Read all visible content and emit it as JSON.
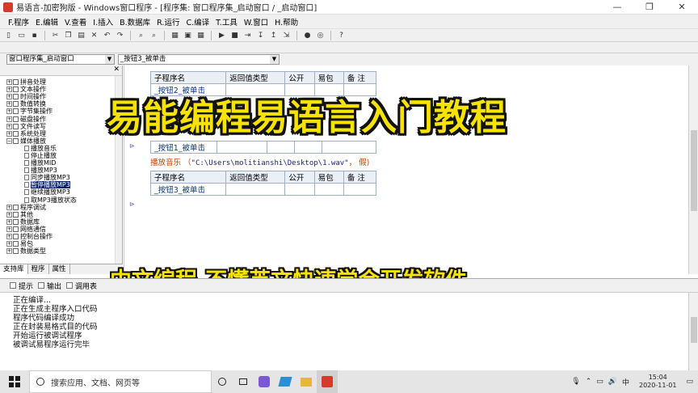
{
  "window": {
    "title": "易语言-加密狗版 - Windows窗口程序 - [程序集: 窗口程序集_启动窗口 / _启动窗口]",
    "controls": [
      "—",
      "❐",
      "✕"
    ]
  },
  "menu": [
    "F.程序",
    "E.编辑",
    "V.查看",
    "I.插入",
    "B.数据库",
    "R.运行",
    "C.编译",
    "T.工具",
    "W.窗口",
    "H.帮助"
  ],
  "selectors": {
    "left": "窗口程序集_启动窗口",
    "right": "_按钮3_被单击"
  },
  "tree": [
    {
      "label": "拼音处理",
      "type": "folder",
      "indent": 0
    },
    {
      "label": "文本操作",
      "type": "folder",
      "indent": 0
    },
    {
      "label": "时间操作",
      "type": "folder",
      "indent": 0
    },
    {
      "label": "数值转换",
      "type": "folder",
      "indent": 0
    },
    {
      "label": "字节集操作",
      "type": "folder",
      "indent": 0
    },
    {
      "label": "磁盘操作",
      "type": "folder",
      "indent": 0
    },
    {
      "label": "文件读写",
      "type": "folder",
      "indent": 0
    },
    {
      "label": "系统处理",
      "type": "folder",
      "indent": 0
    },
    {
      "label": "媒体播放",
      "type": "open",
      "indent": 0
    },
    {
      "label": "播放音乐",
      "type": "leaf",
      "indent": 1
    },
    {
      "label": "停止播放",
      "type": "leaf",
      "indent": 1
    },
    {
      "label": "播放MID",
      "type": "leaf",
      "indent": 1
    },
    {
      "label": "播放MP3",
      "type": "leaf",
      "indent": 1
    },
    {
      "label": "同步播放MP3",
      "type": "leaf",
      "indent": 1
    },
    {
      "label": "暂停播放MP3",
      "type": "leaf",
      "indent": 1,
      "selected": true
    },
    {
      "label": "继续播放MP3",
      "type": "leaf",
      "indent": 1
    },
    {
      "label": "取MP3播放状态",
      "type": "leaf",
      "indent": 1
    },
    {
      "label": "程序调试",
      "type": "folder",
      "indent": 0
    },
    {
      "label": "其他",
      "type": "folder",
      "indent": 0
    },
    {
      "label": "数据库",
      "type": "folder",
      "indent": 0
    },
    {
      "label": "网络通信",
      "type": "folder",
      "indent": 0
    },
    {
      "label": "控制台操作",
      "type": "folder",
      "indent": 0
    },
    {
      "label": "易包",
      "type": "folder",
      "indent": 0
    },
    {
      "label": "数据类型",
      "type": "folder",
      "indent": 0
    }
  ],
  "left_tabs": [
    "支持库",
    "程序",
    "属性"
  ],
  "editor": {
    "headers": [
      "子程序名",
      "返回值类型",
      "公开",
      "易包",
      "备 注"
    ],
    "sub1": "_按钮2_被单击",
    "sub2": "_按钮1_被单击",
    "code": "播放音乐 （",
    "code_str": "\"C:\\Users\\molitianshi\\Desktop\\1.wav\"",
    "code_end": "， 假)",
    "sub3": "_按钮3_被单击"
  },
  "overlay": {
    "title": "易能编程易语言入门教程",
    "subtitle": "中文编程,不懂英文快速学会开发软件"
  },
  "output_tabs": [
    "提示",
    "输出",
    "调用表"
  ],
  "output_lines": [
    "正在编译...",
    "正在生成主程序入口代码",
    "程序代码编译成功",
    "正在封装易格式目的代码",
    "开始运行被调试程序",
    "被调试易程序运行完毕"
  ],
  "taskbar": {
    "search_placeholder": "搜索应用、文档、网页等",
    "ime": "中",
    "time": "15:04",
    "date": "2020-11-01"
  }
}
